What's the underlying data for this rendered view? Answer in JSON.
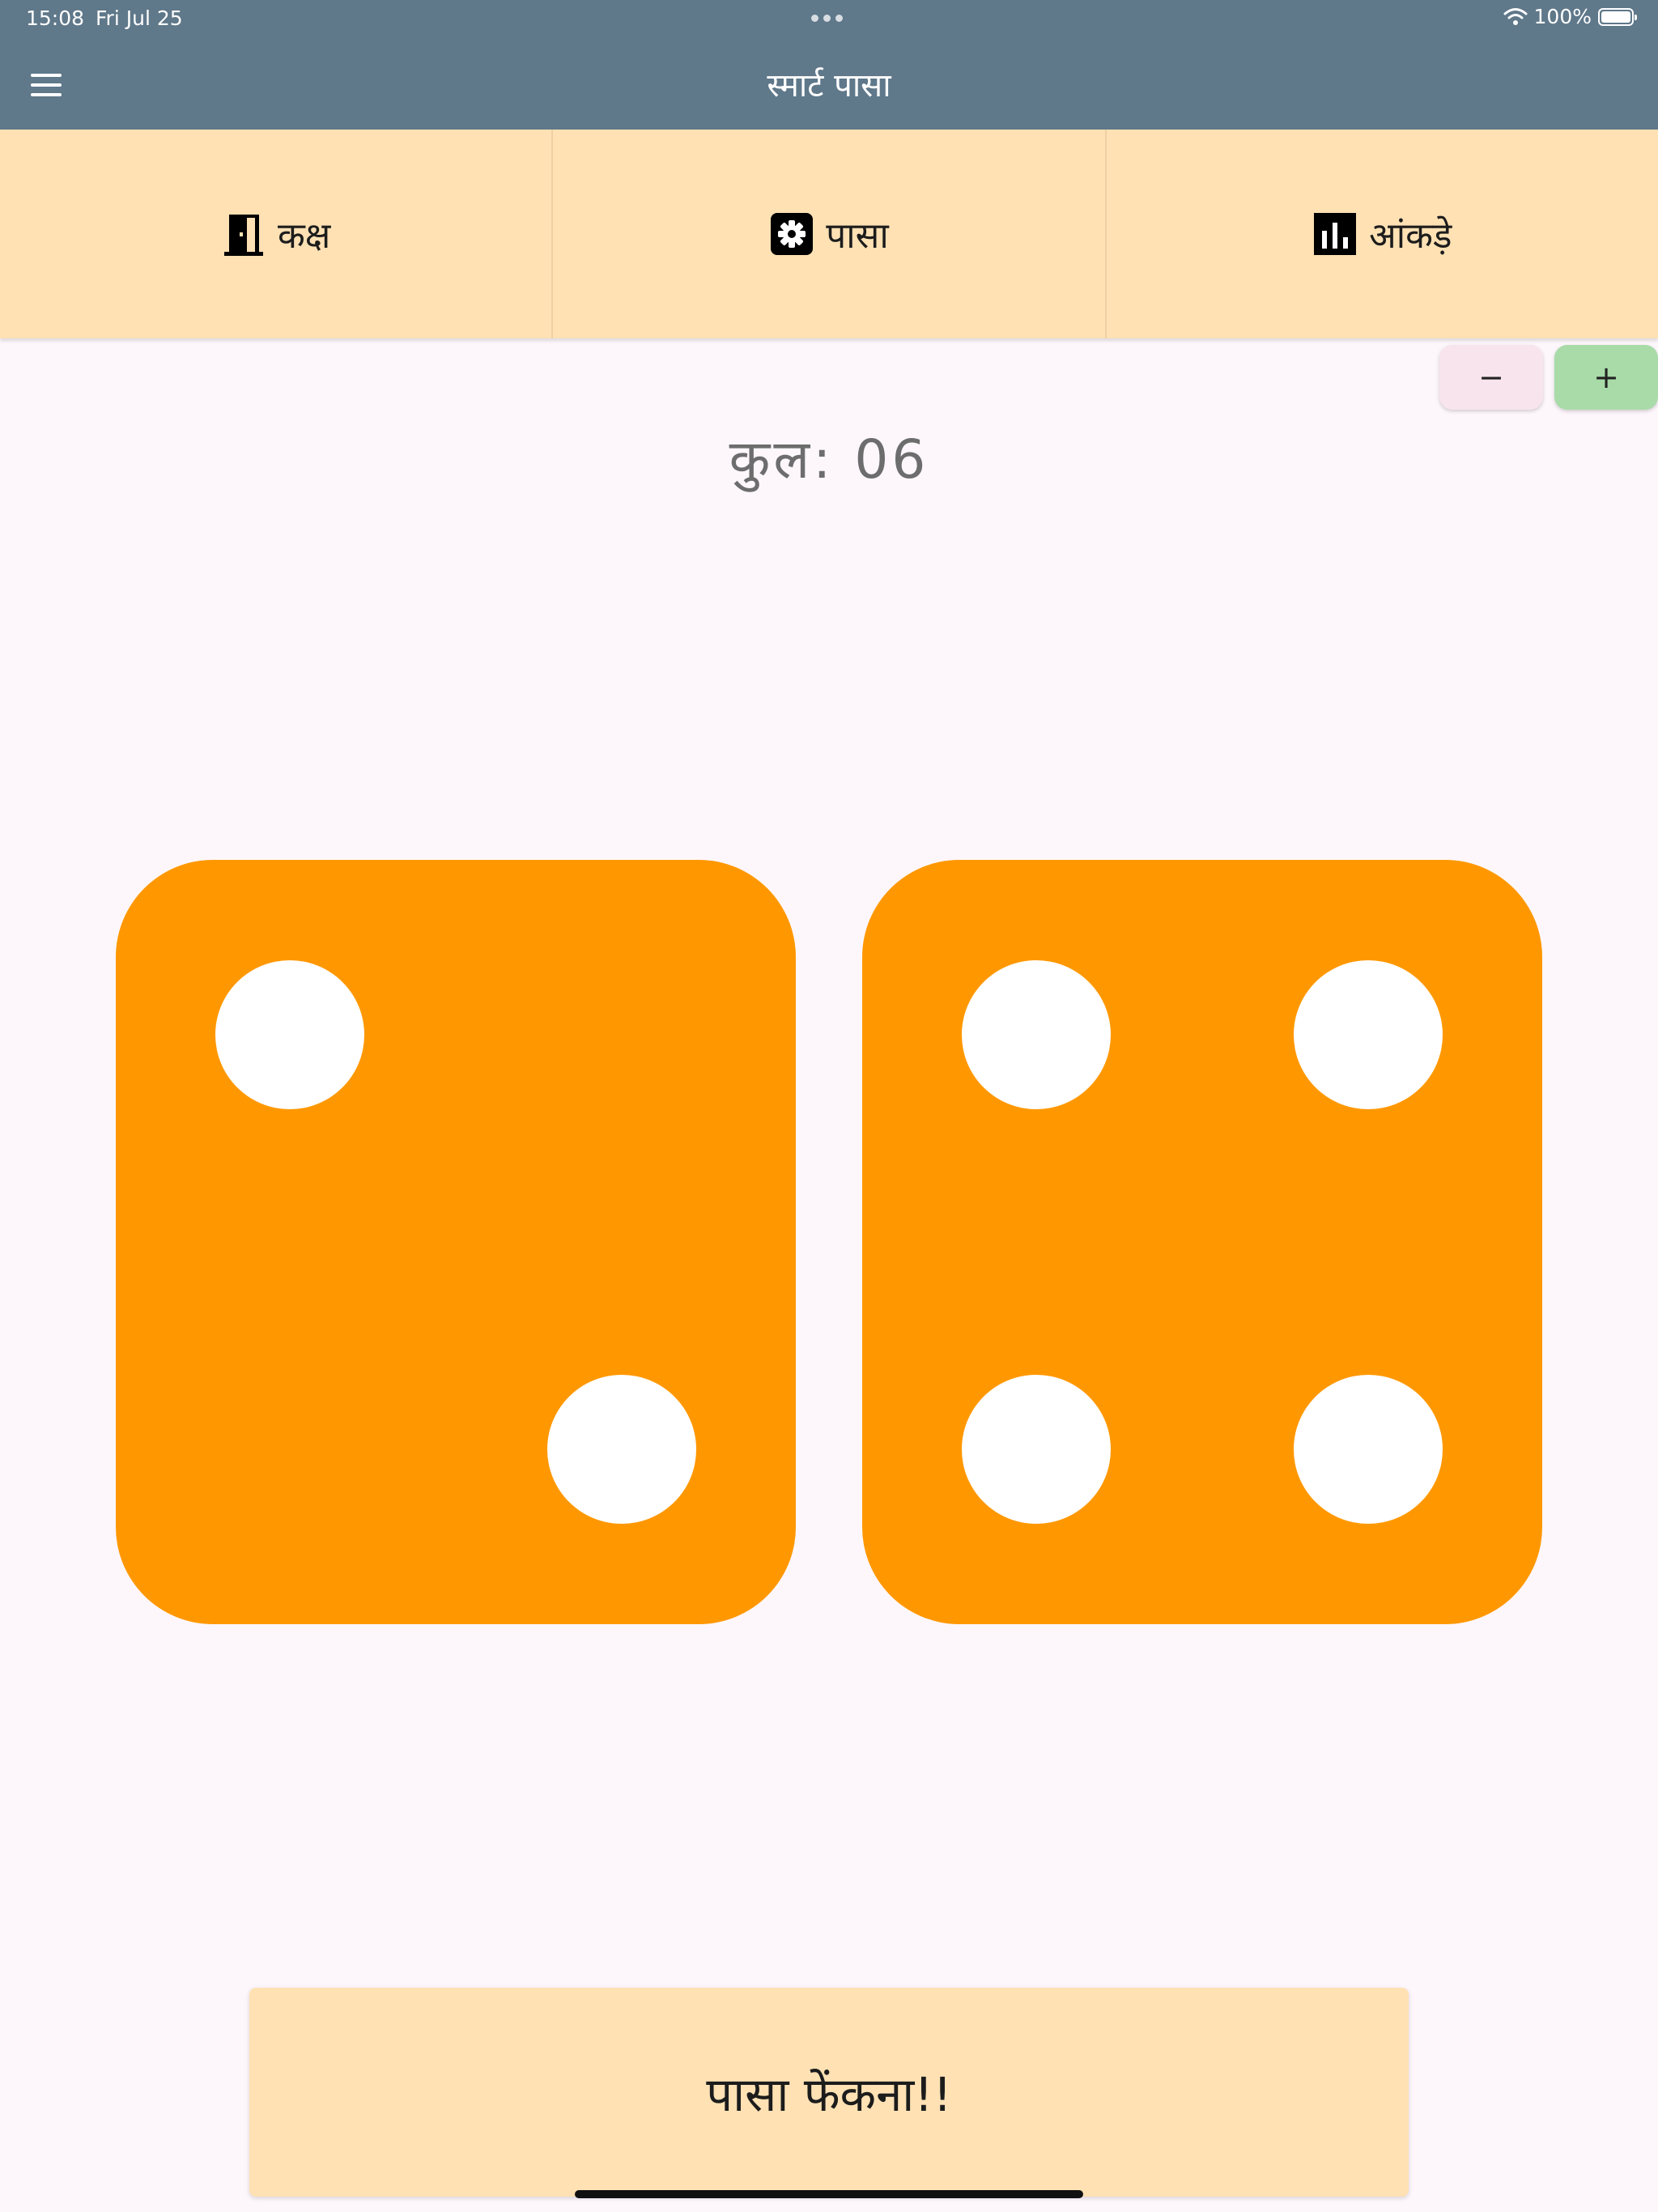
{
  "status_bar": {
    "time": "15:08",
    "date": "Fri Jul 25",
    "battery_text": "100%"
  },
  "app_bar": {
    "title": "स्मार्ट पासा"
  },
  "tabs": [
    {
      "label": "कक्ष",
      "icon": "door-icon"
    },
    {
      "label": "पासा",
      "icon": "dice-settings-icon"
    },
    {
      "label": "आंकड़े",
      "icon": "bar-chart-icon"
    }
  ],
  "stepper": {
    "minus_label": "−",
    "plus_label": "+"
  },
  "total": {
    "text": "कुल: 06"
  },
  "dice": [
    {
      "value": 2,
      "color": "#ff9800"
    },
    {
      "value": 4,
      "color": "#ff9800"
    }
  ],
  "roll_button": {
    "label": "पासा फेंकना!!"
  },
  "colors": {
    "app_bar": "#5f788a",
    "tabs_background": "#ffe1b4",
    "die": "#ff9800",
    "minus_button": "#f8e4ec",
    "plus_button": "#a8dba8",
    "page_background": "#fdf7fc"
  }
}
